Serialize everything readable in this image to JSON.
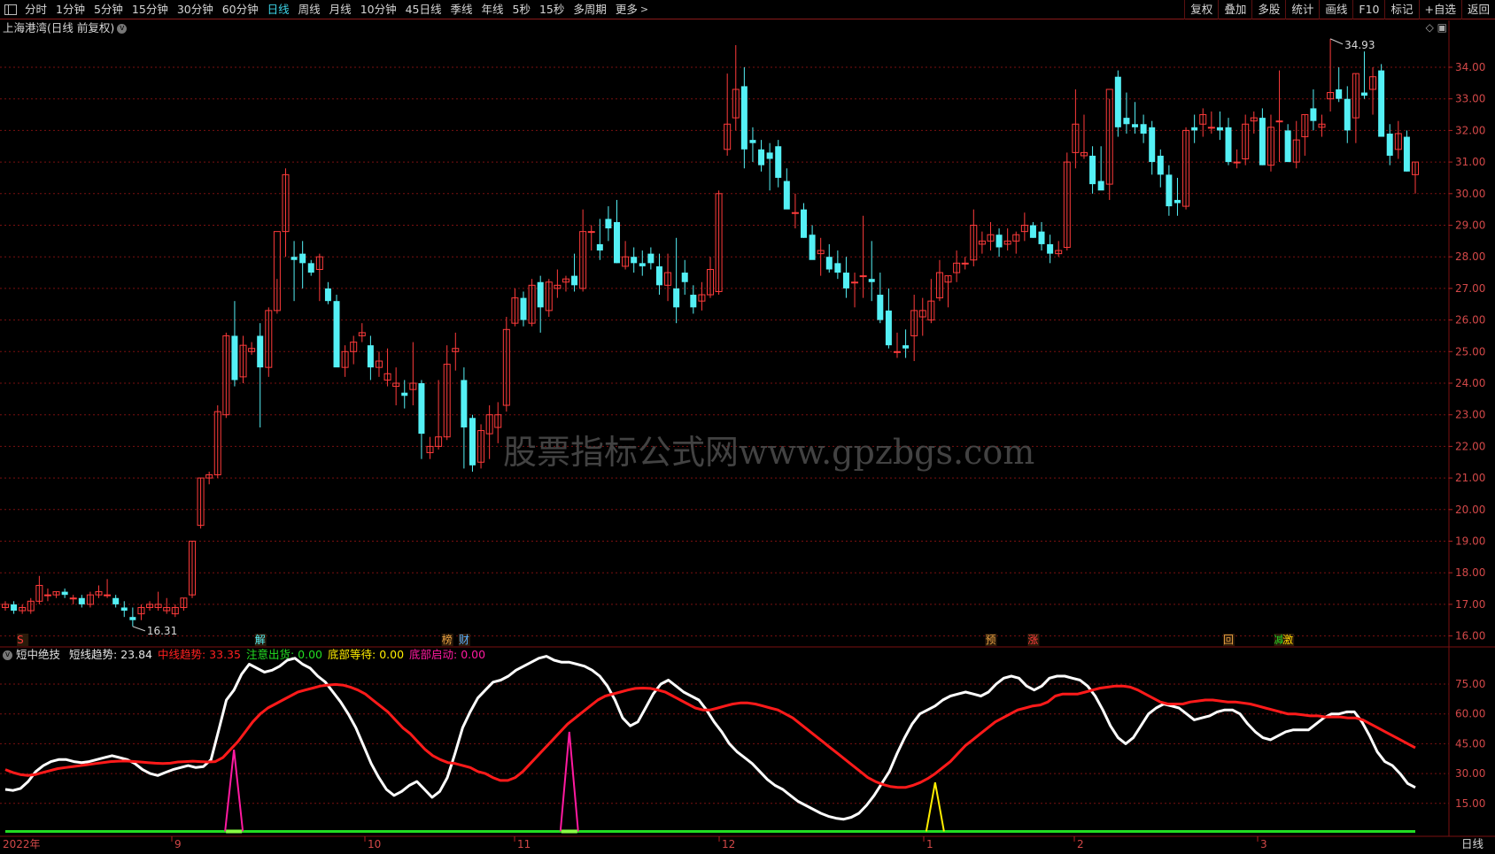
{
  "toolbar": {
    "grid_icon": "grid-icon",
    "periods": [
      "分时",
      "1分钟",
      "5分钟",
      "15分钟",
      "30分钟",
      "60分钟",
      "日线",
      "周线",
      "月线",
      "10分钟",
      "45日线",
      "季线",
      "年线",
      "5秒",
      "15秒",
      "多周期",
      "更多"
    ],
    "active": "日线",
    "right": [
      "复权",
      "叠加",
      "多股",
      "统计",
      "画线",
      "F10",
      "标记",
      "+自选",
      "返回"
    ]
  },
  "title": "上海港湾(日线 前复权)",
  "watermark": "股票指标公式网www.gpzbgs.com",
  "price_axis": {
    "ticks": [
      "34.00",
      "33.00",
      "32.00",
      "31.00",
      "30.00",
      "29.00",
      "28.00",
      "27.00",
      "26.00",
      "25.00",
      "24.00",
      "23.00",
      "22.00",
      "21.00",
      "20.00",
      "19.00",
      "18.00",
      "17.00",
      "16.00"
    ],
    "max_label": "34.93",
    "min_label": "16.31"
  },
  "event_tags": [
    "S",
    "解",
    "榜",
    "财",
    "预",
    "涨",
    "回",
    "减",
    "激"
  ],
  "indicator": {
    "name": "短中绝技",
    "items": [
      {
        "label": "短线趋势: ",
        "value": "23.84",
        "color": "#e6e6e6"
      },
      {
        "label": "中线趋势: ",
        "value": "33.35",
        "color": "#ff2020"
      },
      {
        "label": "注意出货: ",
        "value": "0.00",
        "color": "#22dd22"
      },
      {
        "label": "底部等待: ",
        "value": "0.00",
        "color": "#ffee00"
      },
      {
        "label": "底部启动: ",
        "value": "0.00",
        "color": "#ff1aa0"
      }
    ],
    "ticks": [
      "75.00",
      "60.00",
      "45.00",
      "30.00",
      "15.00"
    ]
  },
  "time_axis": [
    "2022年",
    "9",
    "10",
    "11",
    "12",
    "1",
    "2",
    "3"
  ],
  "period_label": "日线",
  "colors": {
    "up": "#ff3b3b",
    "down": "#54f0f5",
    "grid": "#7a1010"
  },
  "chart_data": {
    "type": "candlestick",
    "candles": [
      [
        16.9,
        17.1,
        16.8,
        17.0
      ],
      [
        17.0,
        17.1,
        16.7,
        16.8
      ],
      [
        16.8,
        17.0,
        16.7,
        16.9
      ],
      [
        16.8,
        17.2,
        16.7,
        17.1
      ],
      [
        17.1,
        17.9,
        17.0,
        17.6
      ],
      [
        17.3,
        17.5,
        17.1,
        17.3
      ],
      [
        17.3,
        17.4,
        17.2,
        17.4
      ],
      [
        17.4,
        17.5,
        17.2,
        17.3
      ],
      [
        17.2,
        17.3,
        17.0,
        17.2
      ],
      [
        17.2,
        17.3,
        16.9,
        17.0
      ],
      [
        17.0,
        17.4,
        16.9,
        17.3
      ],
      [
        17.3,
        17.6,
        17.2,
        17.4
      ],
      [
        17.3,
        17.8,
        17.2,
        17.3
      ],
      [
        17.2,
        17.3,
        16.9,
        17.0
      ],
      [
        16.9,
        17.1,
        16.6,
        16.8
      ],
      [
        16.6,
        16.9,
        16.3,
        16.5
      ],
      [
        16.7,
        17.0,
        16.5,
        16.9
      ],
      [
        16.9,
        17.1,
        16.8,
        17.0
      ],
      [
        16.9,
        17.4,
        16.8,
        17.0
      ],
      [
        16.8,
        17.2,
        16.7,
        16.9
      ],
      [
        16.7,
        17.0,
        16.6,
        16.9
      ],
      [
        16.9,
        17.2,
        16.8,
        17.2
      ],
      [
        17.3,
        19.0,
        17.2,
        19.0
      ],
      [
        19.5,
        21.0,
        19.4,
        21.0
      ],
      [
        21.0,
        21.2,
        20.8,
        21.1
      ],
      [
        21.1,
        23.3,
        21.0,
        23.1
      ],
      [
        23.0,
        25.6,
        22.9,
        25.5
      ],
      [
        25.5,
        26.6,
        23.9,
        24.1
      ],
      [
        24.2,
        25.5,
        24.0,
        25.2
      ],
      [
        25.0,
        25.3,
        24.9,
        25.1
      ],
      [
        25.5,
        25.9,
        22.6,
        24.5
      ],
      [
        24.5,
        26.4,
        24.2,
        26.3
      ],
      [
        26.3,
        27.3,
        26.2,
        28.8
      ],
      [
        28.8,
        30.8,
        28.0,
        30.6
      ],
      [
        28.0,
        28.5,
        26.6,
        27.9
      ],
      [
        28.1,
        28.5,
        27.0,
        27.8
      ],
      [
        27.8,
        27.9,
        27.4,
        27.5
      ],
      [
        27.6,
        28.1,
        26.6,
        28.0
      ],
      [
        27.0,
        27.2,
        26.5,
        26.6
      ],
      [
        26.6,
        26.8,
        25.3,
        24.5
      ],
      [
        24.5,
        25.2,
        24.2,
        25.0
      ],
      [
        25.0,
        25.5,
        24.6,
        25.3
      ],
      [
        25.5,
        25.9,
        25.3,
        25.6
      ],
      [
        25.2,
        25.5,
        24.1,
        24.5
      ],
      [
        24.5,
        25.0,
        24.2,
        24.7
      ],
      [
        24.1,
        25.1,
        23.9,
        24.3
      ],
      [
        23.9,
        24.5,
        23.3,
        24.0
      ],
      [
        23.7,
        24.1,
        23.2,
        23.6
      ],
      [
        23.8,
        25.3,
        23.3,
        24.0
      ],
      [
        24.0,
        24.1,
        21.6,
        22.4
      ],
      [
        21.8,
        22.3,
        21.6,
        22.0
      ],
      [
        22.0,
        24.1,
        21.9,
        22.3
      ],
      [
        22.3,
        25.2,
        22.2,
        24.6
      ],
      [
        25.0,
        25.6,
        24.4,
        25.1
      ],
      [
        24.1,
        24.5,
        21.3,
        22.6
      ],
      [
        22.9,
        23.0,
        21.2,
        21.4
      ],
      [
        21.5,
        22.7,
        21.3,
        22.5
      ],
      [
        22.4,
        23.3,
        21.6,
        23.0
      ],
      [
        22.6,
        23.4,
        22.1,
        23.0
      ],
      [
        23.3,
        26.1,
        23.1,
        25.7
      ],
      [
        25.9,
        27.0,
        25.8,
        26.7
      ],
      [
        26.7,
        26.9,
        25.8,
        26.0
      ],
      [
        25.9,
        27.3,
        25.8,
        27.1
      ],
      [
        27.2,
        27.4,
        25.6,
        26.4
      ],
      [
        26.3,
        27.3,
        26.1,
        27.2
      ],
      [
        27.0,
        27.6,
        26.7,
        27.1
      ],
      [
        27.2,
        27.4,
        26.9,
        27.3
      ],
      [
        27.4,
        28.1,
        26.9,
        27.1
      ],
      [
        27.0,
        29.5,
        26.9,
        28.8
      ],
      [
        28.8,
        29.0,
        28.2,
        28.8
      ],
      [
        28.4,
        29.2,
        27.9,
        28.2
      ],
      [
        29.2,
        29.6,
        28.5,
        28.9
      ],
      [
        29.1,
        29.8,
        27.8,
        27.8
      ],
      [
        27.7,
        28.5,
        27.6,
        28.0
      ],
      [
        28.0,
        28.3,
        27.5,
        27.8
      ],
      [
        27.8,
        28.2,
        27.4,
        27.7
      ],
      [
        28.1,
        28.3,
        27.6,
        27.8
      ],
      [
        27.7,
        28.1,
        26.8,
        27.1
      ],
      [
        27.1,
        28.1,
        26.6,
        27.5
      ],
      [
        27.0,
        28.6,
        25.9,
        26.4
      ],
      [
        27.5,
        27.9,
        26.8,
        27.2
      ],
      [
        26.8,
        27.1,
        26.2,
        26.4
      ],
      [
        26.6,
        27.2,
        26.3,
        26.8
      ],
      [
        26.8,
        28.0,
        26.7,
        27.6
      ],
      [
        26.9,
        30.1,
        26.8,
        30.0
      ],
      [
        31.4,
        33.8,
        31.2,
        32.2
      ],
      [
        32.4,
        34.7,
        32.0,
        33.3
      ],
      [
        33.4,
        34.0,
        30.8,
        31.4
      ],
      [
        31.7,
        32.1,
        31.0,
        31.6
      ],
      [
        31.4,
        31.7,
        30.7,
        30.9
      ],
      [
        31.3,
        31.6,
        30.1,
        31.1
      ],
      [
        31.5,
        31.7,
        30.2,
        30.5
      ],
      [
        30.4,
        30.8,
        29.6,
        29.5
      ],
      [
        29.4,
        30.0,
        28.9,
        29.4
      ],
      [
        29.5,
        29.7,
        28.6,
        28.6
      ],
      [
        28.7,
        29.0,
        28.1,
        27.9
      ],
      [
        28.1,
        28.6,
        27.4,
        28.2
      ],
      [
        28.0,
        28.4,
        27.5,
        27.6
      ],
      [
        27.8,
        28.2,
        27.3,
        27.5
      ],
      [
        27.5,
        28.0,
        26.7,
        27.0
      ],
      [
        27.2,
        27.5,
        26.4,
        27.2
      ],
      [
        27.4,
        29.3,
        26.7,
        27.4
      ],
      [
        27.3,
        28.5,
        26.6,
        27.2
      ],
      [
        26.8,
        27.5,
        25.9,
        26.0
      ],
      [
        26.3,
        27.0,
        25.1,
        25.2
      ],
      [
        25.0,
        25.6,
        24.8,
        25.0
      ],
      [
        25.2,
        25.7,
        24.8,
        25.1
      ],
      [
        25.5,
        26.8,
        24.7,
        26.3
      ],
      [
        26.1,
        26.7,
        25.5,
        26.3
      ],
      [
        26.0,
        27.3,
        25.9,
        26.6
      ],
      [
        26.7,
        27.9,
        26.6,
        27.5
      ],
      [
        27.2,
        27.4,
        26.4,
        27.4
      ],
      [
        27.5,
        28.2,
        27.2,
        27.8
      ],
      [
        27.8,
        28.0,
        27.6,
        27.8
      ],
      [
        27.9,
        29.5,
        27.7,
        29.0
      ],
      [
        28.4,
        28.8,
        28.1,
        28.5
      ],
      [
        28.5,
        29.1,
        28.2,
        28.7
      ],
      [
        28.7,
        28.9,
        28.0,
        28.3
      ],
      [
        28.4,
        28.9,
        28.2,
        28.5
      ],
      [
        28.5,
        28.8,
        28.1,
        28.7
      ],
      [
        28.8,
        29.4,
        28.5,
        29.0
      ],
      [
        29.0,
        29.1,
        28.6,
        28.6
      ],
      [
        28.8,
        29.1,
        28.2,
        28.4
      ],
      [
        28.4,
        28.7,
        27.8,
        28.1
      ],
      [
        28.1,
        28.5,
        28.0,
        28.2
      ],
      [
        28.3,
        31.3,
        28.2,
        31.0
      ],
      [
        31.3,
        33.3,
        30.8,
        32.2
      ],
      [
        31.2,
        32.5,
        31.1,
        31.3
      ],
      [
        31.2,
        31.5,
        30.0,
        30.3
      ],
      [
        30.4,
        31.5,
        30.2,
        30.1
      ],
      [
        30.3,
        33.0,
        29.8,
        33.3
      ],
      [
        33.7,
        33.9,
        31.8,
        32.1
      ],
      [
        32.4,
        33.2,
        31.9,
        32.2
      ],
      [
        32.2,
        32.9,
        31.9,
        32.1
      ],
      [
        32.2,
        32.5,
        31.6,
        31.9
      ],
      [
        32.1,
        32.3,
        30.6,
        31.0
      ],
      [
        31.2,
        31.4,
        30.2,
        30.6
      ],
      [
        30.6,
        30.9,
        29.3,
        29.6
      ],
      [
        29.8,
        30.5,
        29.3,
        29.7
      ],
      [
        29.6,
        32.1,
        29.5,
        32.0
      ],
      [
        32.1,
        32.5,
        31.6,
        32.0
      ],
      [
        32.2,
        32.7,
        31.8,
        32.5
      ],
      [
        32.1,
        32.6,
        31.9,
        32.1
      ],
      [
        32.1,
        32.6,
        31.7,
        32.0
      ],
      [
        32.1,
        32.4,
        30.9,
        31.0
      ],
      [
        31.0,
        31.4,
        30.8,
        31.0
      ],
      [
        31.1,
        32.5,
        30.9,
        32.2
      ],
      [
        32.3,
        32.6,
        31.9,
        32.4
      ],
      [
        32.4,
        32.7,
        30.9,
        30.9
      ],
      [
        30.9,
        32.5,
        30.7,
        32.1
      ],
      [
        32.3,
        33.9,
        31.0,
        32.3
      ],
      [
        32.0,
        32.2,
        31.0,
        31.0
      ],
      [
        31.0,
        32.3,
        30.8,
        31.7
      ],
      [
        31.8,
        32.5,
        31.2,
        32.5
      ],
      [
        32.7,
        33.3,
        32.0,
        32.3
      ],
      [
        32.1,
        32.5,
        31.8,
        32.2
      ],
      [
        33.0,
        34.9,
        32.6,
        33.2
      ],
      [
        33.3,
        34.0,
        32.9,
        33.0
      ],
      [
        33.0,
        33.4,
        31.6,
        32.0
      ],
      [
        32.4,
        33.8,
        31.6,
        33.8
      ],
      [
        33.2,
        34.5,
        33.0,
        33.1
      ],
      [
        33.3,
        34.0,
        32.5,
        33.7
      ],
      [
        33.9,
        34.1,
        31.9,
        31.8
      ],
      [
        31.9,
        32.2,
        30.9,
        31.2
      ],
      [
        31.4,
        32.3,
        31.1,
        31.9
      ],
      [
        31.8,
        32.0,
        30.7,
        30.7
      ],
      [
        30.6,
        31.0,
        30.0,
        31.0
      ]
    ],
    "short_trend": [
      22,
      21.5,
      22.5,
      26,
      31,
      34,
      36,
      37,
      37,
      36,
      35.5,
      36,
      37,
      38,
      39,
      38,
      37,
      35,
      32,
      30,
      29,
      30.5,
      32,
      33,
      34,
      33,
      33.5,
      37,
      52,
      67,
      72,
      80,
      85,
      83,
      81,
      82,
      84,
      87,
      88,
      85,
      83,
      79,
      76,
      71,
      66,
      60,
      53,
      44,
      35,
      28,
      22,
      19,
      21,
      24,
      26,
      22,
      18,
      21,
      28,
      40,
      53,
      61,
      68,
      72,
      76,
      77,
      79,
      82,
      84,
      86,
      88,
      89,
      87,
      86,
      86,
      85,
      84,
      82,
      79,
      74,
      67,
      58,
      54,
      56,
      63,
      70,
      75,
      77,
      74,
      71,
      69,
      67,
      62,
      56,
      51,
      45,
      41,
      38,
      35,
      31,
      27,
      24,
      22,
      19,
      16,
      14,
      12,
      10,
      8.5,
      7.5,
      7,
      8,
      10,
      14,
      19,
      25,
      31,
      40,
      48,
      55,
      60,
      62,
      64,
      67,
      69,
      70,
      71,
      70,
      69,
      71,
      75,
      78,
      79,
      78,
      74,
      72,
      74,
      78,
      79,
      79,
      78,
      77,
      74,
      69,
      62,
      54,
      48,
      45,
      48,
      54,
      60,
      63,
      65,
      64,
      63,
      60,
      57,
      58,
      59,
      61,
      62,
      62,
      60,
      55,
      51,
      48,
      47,
      49,
      51,
      52,
      52,
      52,
      55,
      58,
      60,
      60,
      61,
      61,
      56,
      49,
      41,
      36,
      34,
      30,
      25,
      23
    ],
    "mid_trend": [
      32,
      30.5,
      29.5,
      29,
      29.5,
      30.5,
      31.5,
      32.5,
      33,
      33.5,
      34,
      34.5,
      35,
      35.5,
      36,
      36.2,
      36.3,
      36.1,
      35.8,
      35.5,
      35.2,
      35,
      35.2,
      35.8,
      36,
      36.2,
      36,
      35.8,
      36,
      38,
      42,
      46,
      51,
      56,
      60,
      63,
      65,
      67,
      69,
      71,
      72,
      73,
      74,
      74.5,
      74.8,
      74.5,
      73.5,
      72,
      70,
      67,
      64,
      61,
      57,
      53,
      50,
      46,
      42,
      39,
      37,
      35.5,
      35,
      34,
      33,
      31,
      30,
      28,
      26.5,
      26.5,
      28,
      31,
      35,
      39,
      43,
      47,
      51,
      55,
      58,
      61,
      64,
      67,
      69,
      70,
      71,
      72,
      72.8,
      73,
      72.8,
      72,
      71,
      69,
      67,
      65,
      63,
      62,
      62,
      63,
      64,
      65,
      65.5,
      65.5,
      65,
      64,
      63,
      62,
      60,
      58,
      55,
      52,
      49,
      46,
      43,
      40,
      37,
      34,
      31,
      28,
      26,
      24.5,
      23.5,
      23,
      23,
      24,
      25.5,
      27.5,
      30,
      33,
      36,
      40,
      44,
      47,
      50,
      53,
      56,
      58,
      60,
      62,
      63,
      64,
      64.5,
      66,
      69,
      70,
      70,
      70,
      71,
      72,
      73,
      73.5,
      74,
      74,
      73.5,
      72,
      70,
      68,
      66,
      65,
      65,
      65,
      66,
      66.5,
      67,
      67,
      66.5,
      66,
      66,
      65.5,
      65,
      64,
      63,
      62,
      61,
      60,
      60,
      59.5,
      59,
      59,
      58.5,
      58.5,
      58.5,
      58,
      58,
      57,
      55,
      53,
      51,
      49,
      47,
      45,
      43
    ],
    "markers": [
      {
        "type": "底部启动",
        "index": 30
      },
      {
        "type": "底部启动",
        "index": 74
      },
      {
        "type": "底部等待",
        "index": 122
      }
    ]
  }
}
